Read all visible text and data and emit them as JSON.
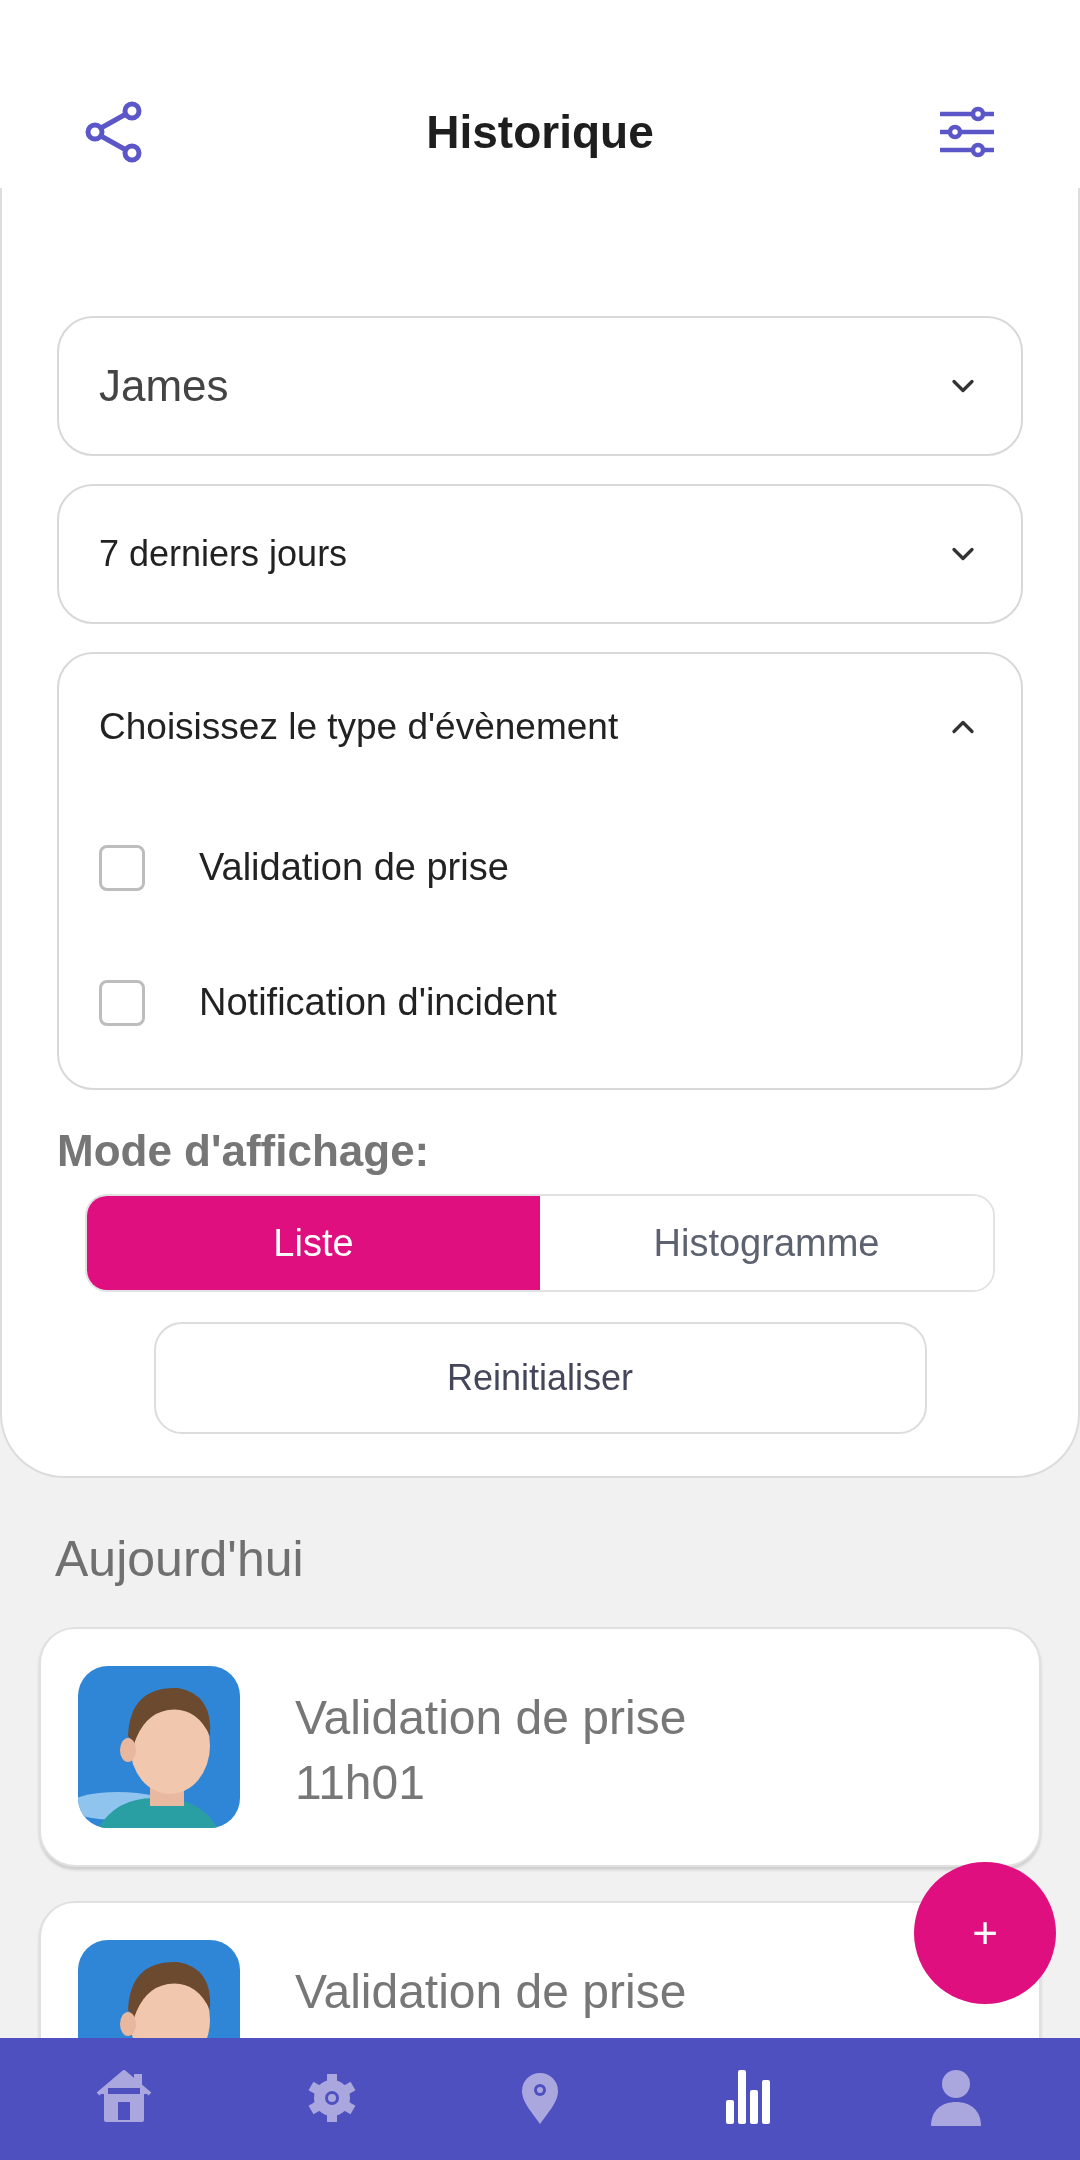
{
  "header": {
    "title": "Historique"
  },
  "filters": {
    "person": {
      "value": "James"
    },
    "period": {
      "value": "7 derniers jours"
    },
    "event_types": {
      "label": "Choisissez le type d'évènement",
      "expanded": true,
      "options": [
        {
          "label": "Validation de prise",
          "checked": false
        },
        {
          "label": "Notification d'incident",
          "checked": false
        }
      ]
    }
  },
  "display_mode": {
    "label": "Mode d'affichage:",
    "options": [
      {
        "label": "Liste",
        "selected": true
      },
      {
        "label": "Histogramme",
        "selected": false
      }
    ]
  },
  "reset_button": "Reinitialiser",
  "section": "Aujourd'hui",
  "events": [
    {
      "title": "Validation de prise",
      "time": "11h01"
    },
    {
      "title": "Validation de prise"
    }
  ],
  "fab": "+",
  "nav": [
    {
      "selected": false
    },
    {
      "selected": false
    },
    {
      "selected": false
    },
    {
      "selected": true
    },
    {
      "selected": false
    }
  ]
}
